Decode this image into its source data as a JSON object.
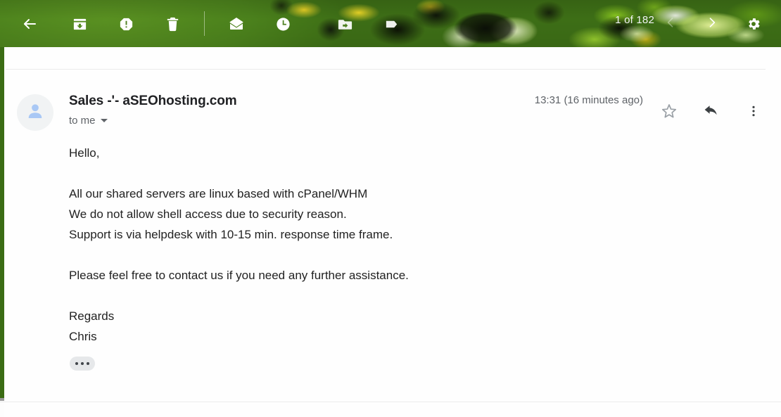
{
  "toolbar": {
    "back_label": "Back to Inbox",
    "archive_label": "Archive",
    "spam_label": "Report spam",
    "delete_label": "Delete",
    "unread_label": "Mark as unread",
    "snooze_label": "Snooze",
    "move_label": "Move to",
    "labels_label": "Labels",
    "counter": "1 of 182",
    "older_label": "Older",
    "newer_label": "Newer",
    "settings_label": "Settings",
    "theme_color": "#4a8020"
  },
  "message": {
    "sender": "Sales -'- aSEOhosting.com",
    "recipient": "to me",
    "timestamp": "13:31 (16 minutes ago)",
    "star_label": "Star",
    "reply_label": "Reply",
    "more_label": "More",
    "body": "Hello,\n\nAll our shared servers are linux based with cPanel/WHM\nWe do not allow shell access due to security reason.\nSupport is via helpdesk with 10-15 min. response time frame.\n\nPlease feel free to contact us if you need any further assistance.\n\nRegards\nChris",
    "trimmed_label": "Show trimmed content"
  }
}
